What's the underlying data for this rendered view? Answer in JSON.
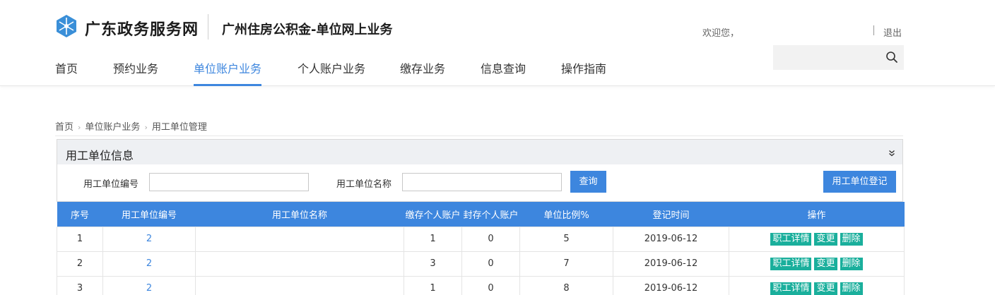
{
  "header": {
    "logo_text": "广东政务服务网",
    "site_subtitle": "广州住房公积金-单位网上业务",
    "welcome": "欢迎您，",
    "logout": "退出",
    "search_placeholder": ""
  },
  "nav": {
    "items": [
      "首页",
      "预约业务",
      "单位账户业务",
      "个人账户业务",
      "缴存业务",
      "信息查询",
      "操作指南"
    ],
    "active_index": 2
  },
  "breadcrumb": [
    "首页",
    "单位账户业务",
    "用工单位管理"
  ],
  "panel": {
    "title": "用工单位信息",
    "code_label": "用工单位编号",
    "name_label": "用工单位名称",
    "code_value": "",
    "name_value": "",
    "query_button": "查询",
    "register_button": "用工单位登记"
  },
  "table": {
    "headers": [
      "序号",
      "用工单位编号",
      "用工单位名称",
      "缴存个人账户",
      "封存个人账户",
      "单位比例%",
      "登记时间",
      "操作"
    ],
    "rows": [
      {
        "index": "1",
        "code": "2",
        "name": "",
        "deposit": "1",
        "sealed": "0",
        "ratio": "5",
        "date": "2019-06-12"
      },
      {
        "index": "2",
        "code": "2",
        "name": "",
        "deposit": "3",
        "sealed": "0",
        "ratio": "7",
        "date": "2019-06-12"
      },
      {
        "index": "3",
        "code": "2",
        "name": "",
        "deposit": "1",
        "sealed": "0",
        "ratio": "8",
        "date": "2019-06-12"
      }
    ],
    "actions": [
      "职工详情",
      "变更",
      "删除"
    ]
  },
  "colors": {
    "primary": "#3d86de",
    "action": "#1aaf9c",
    "logo": "#3a8fd8"
  },
  "icons": {
    "logo": "gdzwfw-logo-icon",
    "search": "search-icon",
    "collapse": "double-chevron-down-icon"
  }
}
